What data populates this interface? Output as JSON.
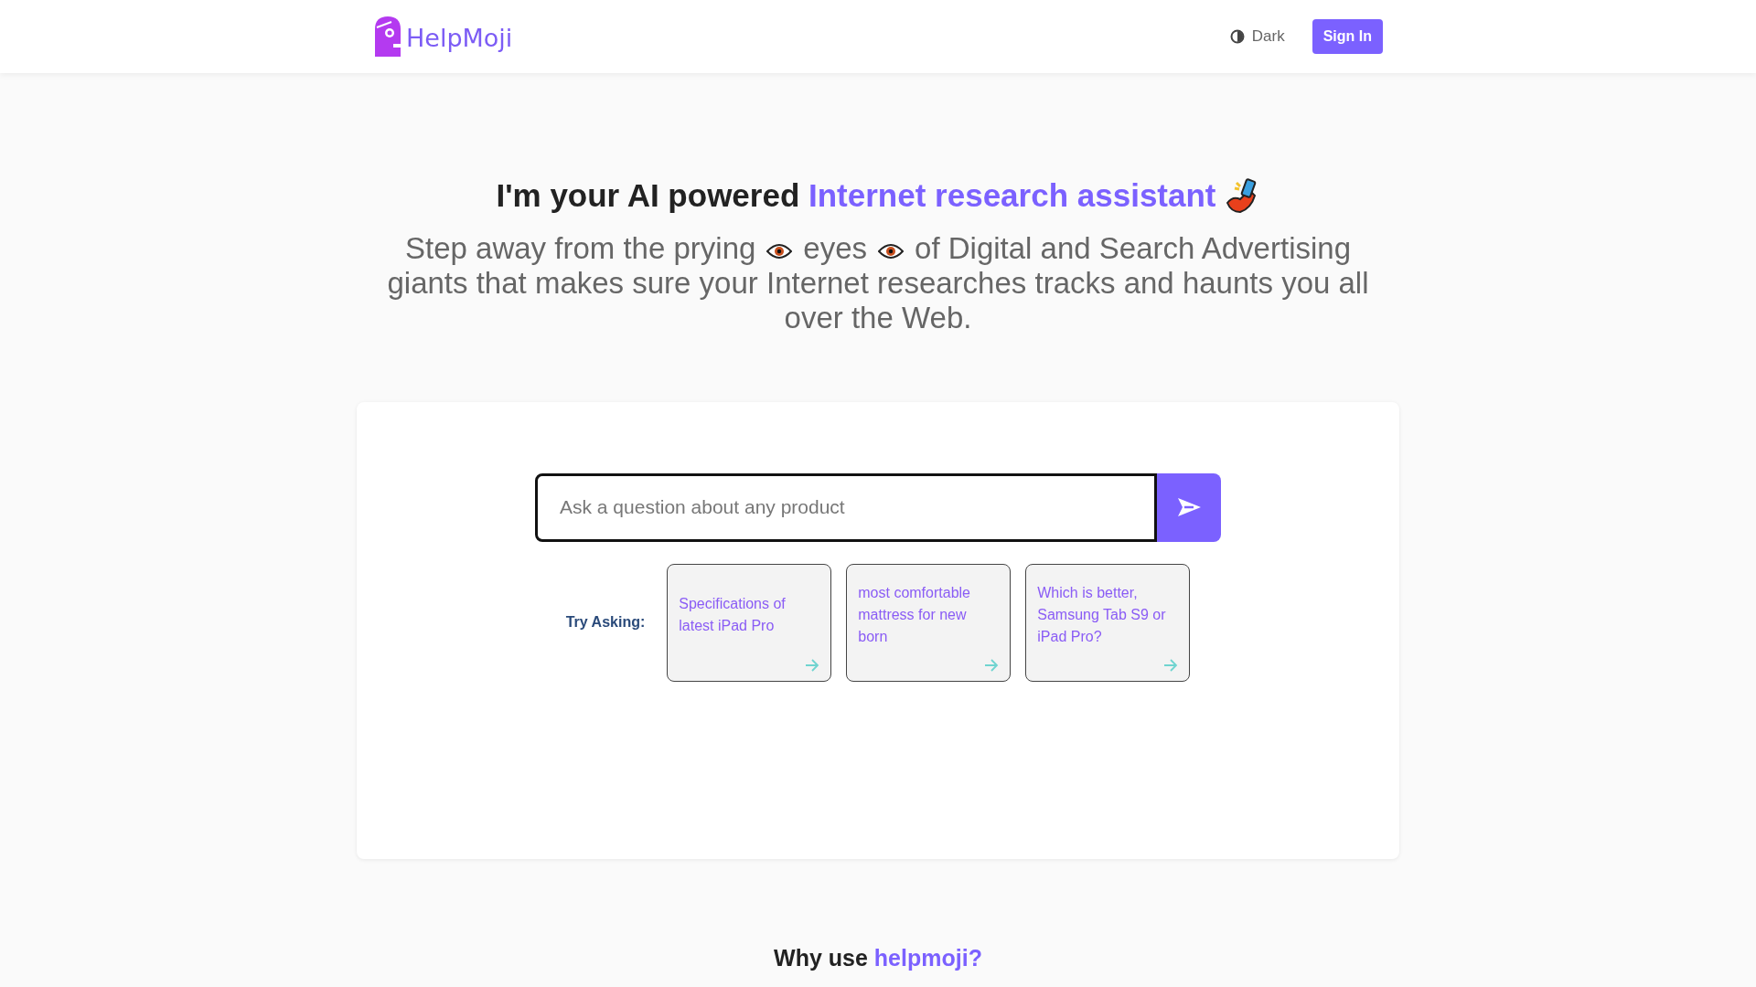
{
  "navbar": {
    "brand": "HelpMoji",
    "theme_toggle": "Dark",
    "sign_in": "Sign In"
  },
  "hero": {
    "headline": "I'm your AI powered",
    "headline_highlight": "Internet research assistant",
    "subtitle_lines": [
      [
        {
          "kind": "text",
          "text": "Step away from the prying"
        },
        {
          "kind": "eye"
        },
        {
          "kind": "text",
          "text": "eyes"
        },
        {
          "kind": "eye"
        },
        {
          "kind": "text",
          "text": "of Digital and Search Advertising"
        }
      ],
      [
        {
          "kind": "text",
          "text": "giants that makes sure your Internet researches tracks and haunts you all"
        }
      ],
      [
        {
          "kind": "text",
          "text": "over the Web."
        }
      ]
    ]
  },
  "search": {
    "placeholder": "Ask a question about any product"
  },
  "suggestions": {
    "label": "Try Asking:",
    "items": [
      "Specifications of latest iPad Pro",
      "most comfortable mattress for new born",
      "Which is better, Samsung Tab S9 or iPad Pro?"
    ]
  },
  "why": {
    "text": "Why use",
    "highlight": "helpmoji?"
  }
}
